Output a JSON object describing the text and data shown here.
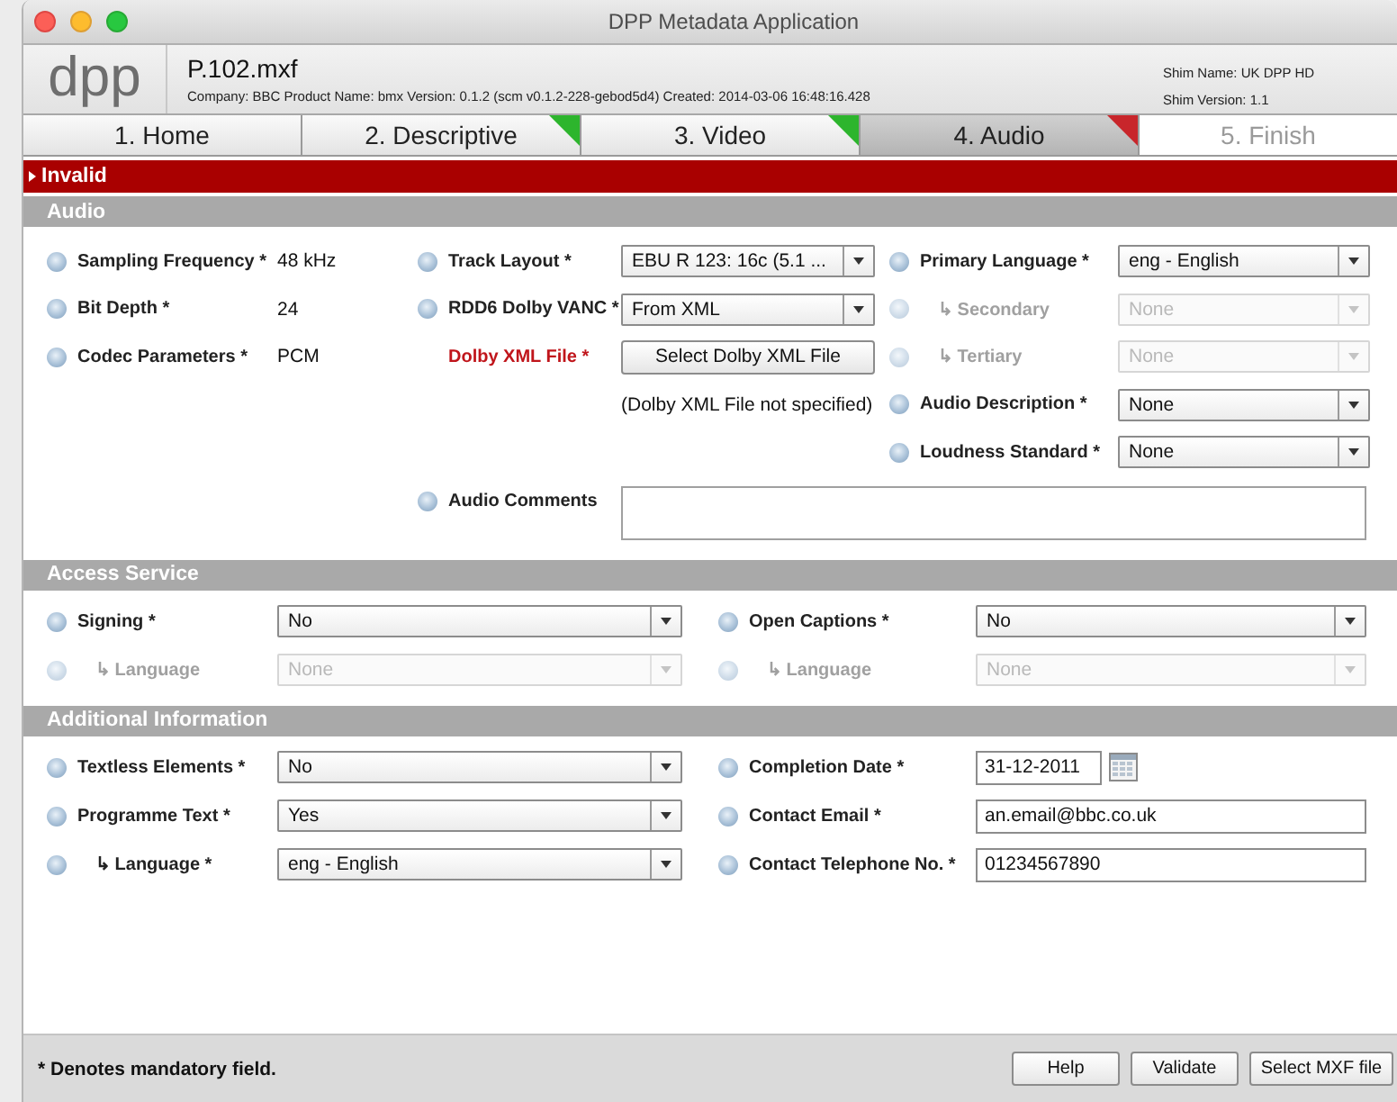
{
  "window": {
    "title": "DPP Metadata Application"
  },
  "header": {
    "logo": "dpp",
    "file_name": "P.102.mxf",
    "details": "Company: BBC  Product Name: bmx  Version: 0.1.2 (scm v0.1.2-228-gebod5d4)  Created: 2014-03-06 16:48:16.428",
    "shim_name": "Shim Name: UK DPP HD",
    "shim_version": "Shim Version: 1.1"
  },
  "tabs": [
    {
      "label": "1. Home",
      "selected": false,
      "disabled": false
    },
    {
      "label": "2. Descriptive",
      "selected": false,
      "disabled": false,
      "color": "#2db52d"
    },
    {
      "label": "3. Video",
      "selected": false,
      "disabled": false,
      "color": "#2db52d"
    },
    {
      "label": "4. Audio",
      "selected": true,
      "disabled": false,
      "color": "#c8262b"
    },
    {
      "label": "5. Finish",
      "selected": false,
      "disabled": true
    }
  ],
  "status_bar": {
    "text": "Invalid",
    "expanded": false
  },
  "audio": {
    "title": "Audio",
    "columns": [
      [
        {
          "kind": "value",
          "label": "Sampling Frequency *",
          "value": "48 kHz",
          "help": true,
          "sub": false,
          "disabled": false,
          "error": false
        },
        {
          "kind": "value",
          "label": "Bit Depth *",
          "value": "24",
          "help": true,
          "sub": false,
          "disabled": false,
          "error": false
        },
        {
          "kind": "value",
          "label": "Codec Parameters *",
          "value": "PCM",
          "help": true,
          "sub": false,
          "disabled": false,
          "error": false
        }
      ],
      [
        {
          "kind": "select",
          "label": "Track Layout *",
          "value": "EBU R 123: 16c (5.1 ...",
          "help": true,
          "sub": false,
          "disabled": false,
          "error": false
        },
        {
          "kind": "select",
          "label": "RDD6 Dolby VANC *",
          "value": "From XML",
          "help": true,
          "sub": false,
          "disabled": false,
          "error": false
        },
        {
          "kind": "button",
          "label": "Dolby XML File *",
          "value": "Select Dolby XML File",
          "help": false,
          "sub": false,
          "disabled": false,
          "error": true
        },
        {
          "kind": "note",
          "value": "(Dolby XML File not specified)",
          "help": false,
          "sub": false,
          "disabled": false,
          "error": false
        }
      ],
      [
        {
          "kind": "select",
          "label": "Primary Language *",
          "value": "eng - English",
          "help": true,
          "sub": false,
          "disabled": false,
          "error": false
        },
        {
          "kind": "select",
          "label": "↳ Secondary",
          "value": "None",
          "help": true,
          "sub": true,
          "disabled": true,
          "error": false
        },
        {
          "kind": "select",
          "label": "↳ Tertiary",
          "value": "None",
          "help": true,
          "sub": true,
          "disabled": true,
          "error": false
        },
        {
          "kind": "select",
          "label": "Audio Description *",
          "value": "None",
          "help": true,
          "sub": false,
          "disabled": false,
          "error": false
        },
        {
          "kind": "select",
          "label": "Loudness Standard *",
          "value": "None",
          "help": true,
          "sub": false,
          "disabled": false,
          "error": false
        }
      ]
    ],
    "comments": {
      "kind": "textarea",
      "label": "Audio Comments",
      "help": true,
      "sub": false,
      "disabled": false,
      "error": false
    }
  },
  "access_service": {
    "title": "Access Service",
    "rows": [
      [
        {
          "kind": "select",
          "label": "Signing *",
          "value": "No",
          "help": true,
          "sub": false,
          "disabled": false,
          "error": false
        },
        {
          "kind": "select",
          "label": "Open Captions *",
          "value": "No",
          "help": true,
          "sub": false,
          "disabled": false,
          "error": false
        }
      ],
      [
        {
          "kind": "select",
          "label": "↳ Language",
          "value": "None",
          "help": true,
          "sub": true,
          "disabled": true,
          "error": false
        },
        {
          "kind": "select",
          "label": "↳ Language",
          "value": "None",
          "help": true,
          "sub": true,
          "disabled": true,
          "error": false
        }
      ]
    ]
  },
  "additional_information": {
    "title": "Additional Information",
    "rows": [
      [
        {
          "kind": "select",
          "label": "Textless Elements *",
          "value": "No",
          "help": true,
          "sub": false,
          "disabled": false,
          "error": false
        },
        {
          "kind": "date",
          "label": "Completion Date *",
          "value": "31-12-2011",
          "help": true,
          "sub": false,
          "disabled": false,
          "error": false
        }
      ],
      [
        {
          "kind": "select",
          "label": "Programme Text *",
          "value": "Yes",
          "help": true,
          "sub": false,
          "disabled": false,
          "error": false
        },
        {
          "kind": "text",
          "label": "Contact Email *",
          "value": "an.email@bbc.co.uk",
          "help": true,
          "sub": false,
          "disabled": false,
          "error": false
        }
      ],
      [
        {
          "kind": "select",
          "label": "↳ Language *",
          "value": "eng - English",
          "help": true,
          "sub": true,
          "disabled": false,
          "error": false
        },
        {
          "kind": "text",
          "label": "Contact Telephone No. *",
          "value": "01234567890",
          "help": true,
          "sub": false,
          "disabled": false,
          "error": false
        }
      ]
    ]
  },
  "footer": {
    "note": "* Denotes mandatory field.",
    "buttons": [
      "Help",
      "Validate",
      "Select MXF file"
    ]
  }
}
